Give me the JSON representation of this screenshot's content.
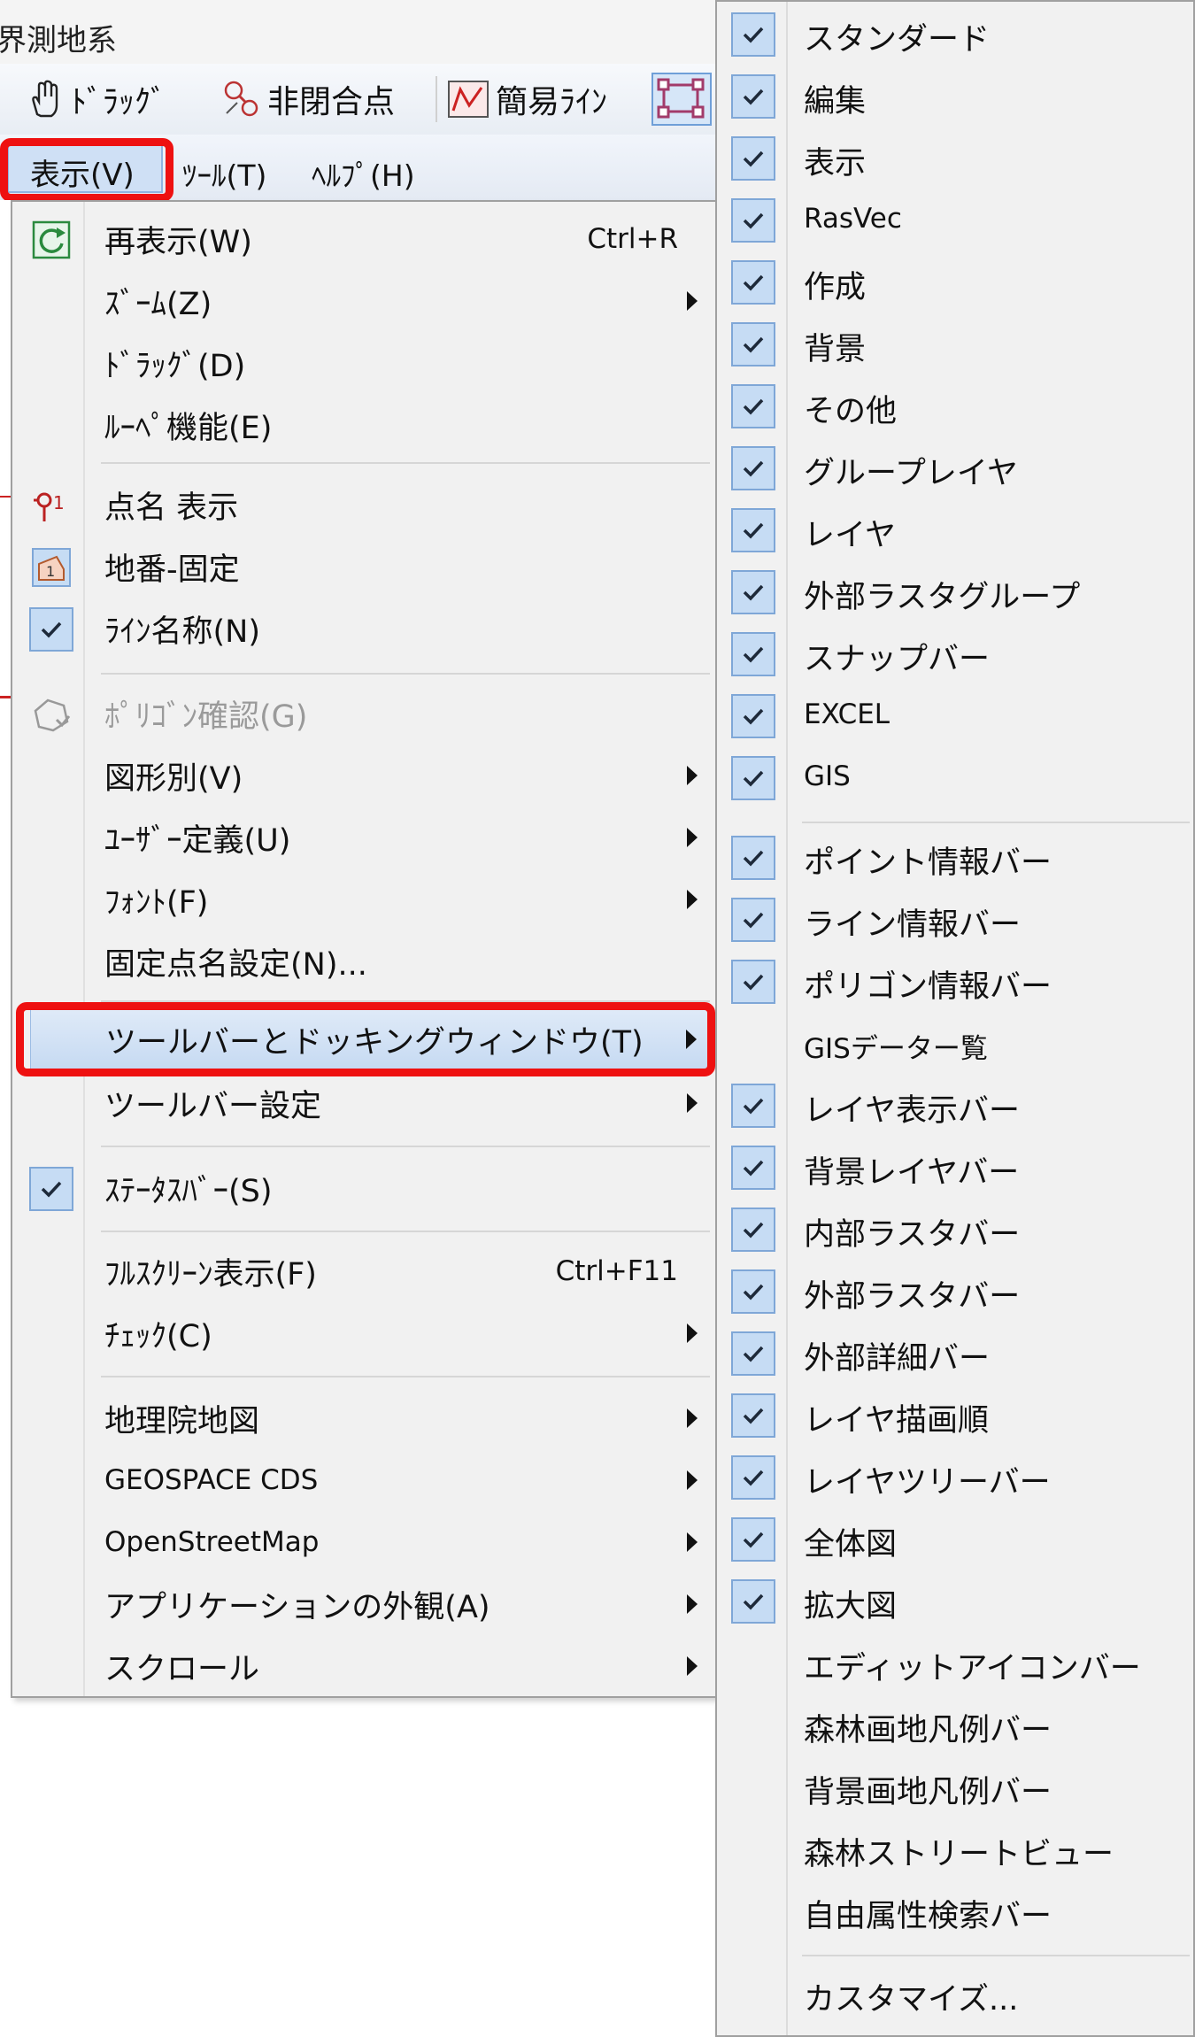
{
  "window": {
    "title": "界測地系"
  },
  "toolbar": {
    "drag_label": "ﾄﾞﾗｯｸﾞ",
    "nonclosed_label": "非閉合点",
    "simple_line_label": "簡易ﾗｲﾝ"
  },
  "menubar": {
    "view": "表示(V)",
    "tools": "ﾂｰﾙ(T)",
    "help": "ﾍﾙﾌﾟ(H)"
  },
  "view_menu": {
    "items": [
      {
        "label": "再表示(W)",
        "shortcut": "Ctrl+R"
      },
      {
        "label": "ｽﾞｰﾑ(Z)"
      },
      {
        "label": "ﾄﾞﾗｯｸﾞ(D)"
      },
      {
        "label": "ﾙｰﾍﾟ機能(E)"
      },
      {
        "label": "点名 表示"
      },
      {
        "label": "地番-固定"
      },
      {
        "label": "ﾗｲﾝ名称(N)"
      },
      {
        "label": "ﾎﾟﾘｺﾞﾝ確認(G)"
      },
      {
        "label": "図形別(V)"
      },
      {
        "label": "ﾕｰｻﾞｰ定義(U)"
      },
      {
        "label": "ﾌｫﾝﾄ(F)"
      },
      {
        "label": "固定点名設定(N)..."
      },
      {
        "label": "ツールバーとドッキングウィンドウ(T)"
      },
      {
        "label": "ツールバー設定"
      },
      {
        "label": "ｽﾃｰﾀｽﾊﾞｰ(S)"
      },
      {
        "label": "ﾌﾙｽｸﾘｰﾝ表示(F)",
        "shortcut": "Ctrl+F11"
      },
      {
        "label": "ﾁｪｯｸ(C)"
      },
      {
        "label": "地理院地図"
      },
      {
        "label": "GEOSPACE CDS"
      },
      {
        "label": "OpenStreetMap"
      },
      {
        "label": "アプリケーションの外観(A)"
      },
      {
        "label": "スクロール"
      }
    ]
  },
  "sub_menu": {
    "items": [
      {
        "label": "スタンダード",
        "checked": true
      },
      {
        "label": "編集",
        "checked": true
      },
      {
        "label": "表示",
        "checked": true
      },
      {
        "label": "RasVec",
        "checked": true
      },
      {
        "label": "作成",
        "checked": true
      },
      {
        "label": "背景",
        "checked": true
      },
      {
        "label": "その他",
        "checked": true
      },
      {
        "label": "グループレイヤ",
        "checked": true
      },
      {
        "label": "レイヤ",
        "checked": true
      },
      {
        "label": "外部ラスタグループ",
        "checked": true
      },
      {
        "label": "スナップバー",
        "checked": true
      },
      {
        "label": "EXCEL",
        "checked": true
      },
      {
        "label": "GIS",
        "checked": true
      },
      {
        "label": "ポイント情報バー",
        "checked": true
      },
      {
        "label": "ライン情報バー",
        "checked": true
      },
      {
        "label": "ポリゴン情報バー",
        "checked": true
      },
      {
        "label": "GISデーター覧",
        "checked": false
      },
      {
        "label": "レイヤ表示バー",
        "checked": true
      },
      {
        "label": "背景レイヤバー",
        "checked": true
      },
      {
        "label": "内部ラスタバー",
        "checked": true
      },
      {
        "label": "外部ラスタバー",
        "checked": true
      },
      {
        "label": "外部詳細バー",
        "checked": true
      },
      {
        "label": "レイヤ描画順",
        "checked": true
      },
      {
        "label": "レイヤツリーバー",
        "checked": true
      },
      {
        "label": "全体図",
        "checked": true
      },
      {
        "label": "拡大図",
        "checked": true
      },
      {
        "label": "エディットアイコンバー",
        "checked": false
      },
      {
        "label": "森林画地凡例バー",
        "checked": false
      },
      {
        "label": "背景画地凡例バー",
        "checked": false
      },
      {
        "label": "森林ストリートビュー",
        "checked": false
      },
      {
        "label": "自由属性検索バー",
        "checked": false
      },
      {
        "label": "カスタマイズ...",
        "checked": false
      }
    ]
  },
  "colors": {
    "highlight_border": "#ee1111",
    "check_bg": "#c6dcf4"
  }
}
